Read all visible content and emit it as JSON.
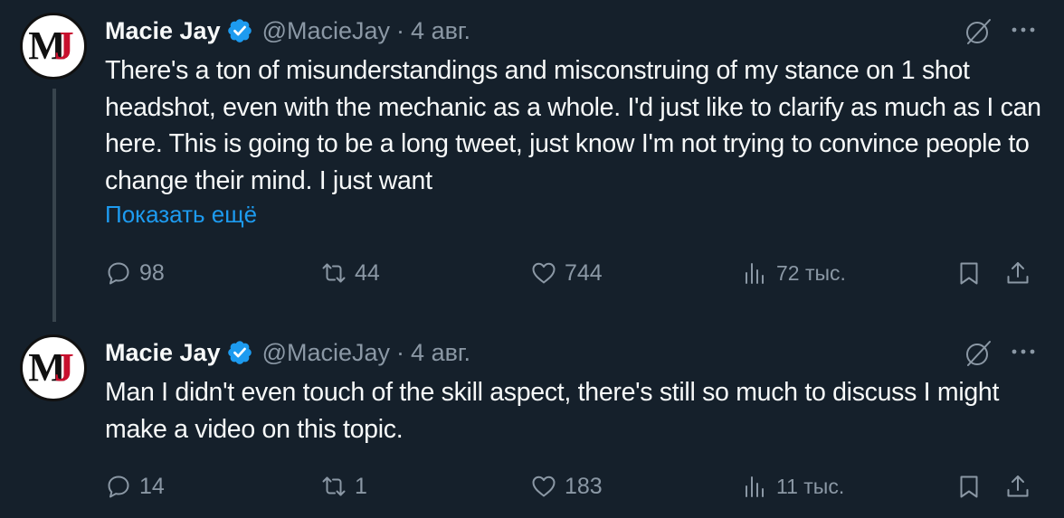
{
  "tweets": [
    {
      "avatar_initials": {
        "m": "M",
        "j": "J"
      },
      "name": "Macie Jay",
      "handle": "@MacieJay",
      "separator": "·",
      "date": "4 авг.",
      "text": "There's a ton of misunderstandings and misconstruing of my stance on 1 shot headshot, even with the mechanic as a whole. I'd just like to clarify as much as I can here. This is going to be a long tweet, just know I'm not trying to convince people to change their mind. I just want",
      "show_more": "Показать ещё",
      "replies": "98",
      "reposts": "44",
      "likes": "744",
      "views": "72 тыс."
    },
    {
      "avatar_initials": {
        "m": "M",
        "j": "J"
      },
      "name": "Macie Jay",
      "handle": "@MacieJay",
      "separator": "·",
      "date": "4 авг.",
      "text": "Man I didn't even touch of the skill aspect, there's still so much to discuss I might make a video on this topic.",
      "replies": "14",
      "reposts": "1",
      "likes": "183",
      "views": "11 тыс."
    }
  ],
  "colors": {
    "background": "#15202b",
    "text": "#f7f9f9",
    "muted": "#8b98a5",
    "link": "#1d9bf0",
    "verified": "#1d9bf0"
  },
  "icons": [
    "verified-badge-icon",
    "grok-icon",
    "more-icon",
    "reply-icon",
    "repost-icon",
    "like-icon",
    "views-icon",
    "bookmark-icon",
    "share-icon"
  ]
}
